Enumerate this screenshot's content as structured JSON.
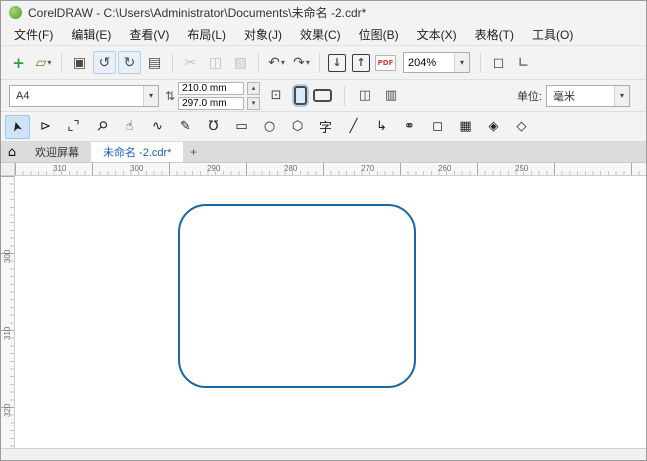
{
  "window": {
    "title": "CorelDRAW - C:\\Users\\Administrator\\Documents\\未命名 -2.cdr*"
  },
  "menu": {
    "items": [
      "文件(F)",
      "编辑(E)",
      "查看(V)",
      "布局(L)",
      "对象(J)",
      "效果(C)",
      "位图(B)",
      "文本(X)",
      "表格(T)",
      "工具(O)"
    ]
  },
  "toolbar": {
    "zoom_value": "204%",
    "icons": {
      "new_document": "+",
      "open": "▱",
      "save": "▣",
      "cloud_open": "↺",
      "cloud_save": "↻",
      "print": "▤",
      "cut": "✂",
      "copy": "◫",
      "paste": "▨",
      "undo": "↶",
      "redo": "↷",
      "import": "↓",
      "export": "↑",
      "pdf": "PDF",
      "fullscreen": "◻",
      "rulers": "∟",
      "dropdown": "▾"
    }
  },
  "property_bar": {
    "page_size_value": "A4",
    "page_width": "210.0 mm",
    "page_height": "297.0 mm",
    "units_label": "单位:",
    "units_value": "毫米",
    "icons": {
      "dimensions": "⇅",
      "stepper_up": "▴",
      "stepper_down": "▾",
      "fit_page": "⊡",
      "pages": "◫",
      "page_layout": "▥",
      "dropdown": "▾"
    }
  },
  "toolbox": {
    "tools": [
      {
        "name": "pick-tool",
        "glyph": "➤",
        "cls": "rot-up",
        "selected": true
      },
      {
        "name": "shape-tool",
        "glyph": "⊳"
      },
      {
        "name": "crop-tool",
        "glyph": "⌞⌝"
      },
      {
        "name": "zoom-tool",
        "glyph": "⚲",
        "cls": "rot-45"
      },
      {
        "name": "pan-tool",
        "glyph": "☝"
      },
      {
        "name": "freehand-tool",
        "glyph": "∿"
      },
      {
        "name": "pen-tool",
        "glyph": "✎"
      },
      {
        "name": "bezier-tool",
        "glyph": "℧"
      },
      {
        "name": "rectangle-tool",
        "glyph": "▭"
      },
      {
        "name": "ellipse-tool",
        "glyph": "○"
      },
      {
        "name": "polygon-tool",
        "glyph": "⬡"
      },
      {
        "name": "text-tool",
        "glyph": "字"
      },
      {
        "name": "dimension-tool",
        "glyph": "╱"
      },
      {
        "name": "connector-tool",
        "glyph": "↳"
      },
      {
        "name": "eyedropper-tool",
        "glyph": "⚭"
      },
      {
        "name": "outline-pen-tool",
        "glyph": "◻"
      },
      {
        "name": "transparency-tool",
        "glyph": "▦"
      },
      {
        "name": "interactive-fill-tool",
        "glyph": "◈"
      },
      {
        "name": "smart-fill-tool",
        "glyph": "◇"
      }
    ]
  },
  "tabs": {
    "home_icon": "⌂",
    "welcome": "欢迎屏幕",
    "document": "未命名 -2.cdr*",
    "add": "+"
  },
  "rulers": {
    "horizontal": [
      "310",
      "300",
      "290",
      "280",
      "270",
      "260",
      "250"
    ],
    "vertical": [
      "300",
      "310",
      "320"
    ]
  },
  "canvas": {
    "shape": "rounded-rectangle",
    "stroke_color": "#1a66a2"
  },
  "colors": {
    "accent": "#1e5fae",
    "toolbar_bg": "#f3f3f3"
  }
}
